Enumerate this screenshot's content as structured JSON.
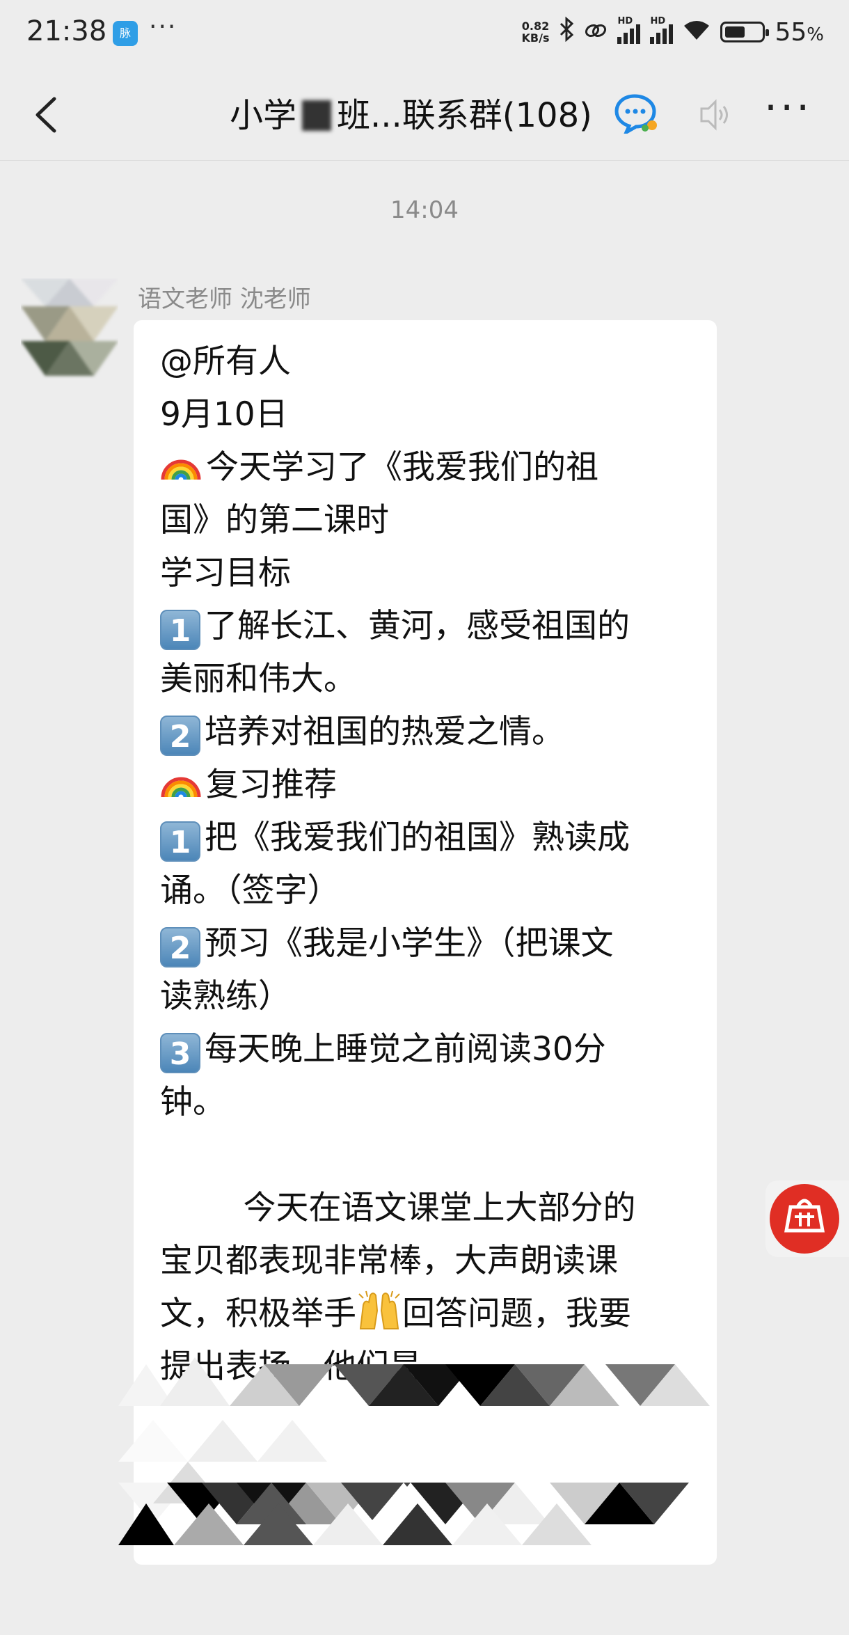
{
  "status_bar": {
    "time": "21:38",
    "app_icon_text": "脉",
    "more_dots": "···",
    "net_speed_value": "0.82",
    "net_speed_unit": "KB/s",
    "hd_label": "HD",
    "battery_percent": "55",
    "battery_suffix": "%"
  },
  "header": {
    "title_part1": "小学",
    "title_part2": "班...联系群(108)",
    "back_icon": "chevron-left-icon",
    "more_icon": "more-dots-icon",
    "more_label": "···"
  },
  "chat": {
    "timestamp": "14:04",
    "message": {
      "sender": "语文老师 沈老师",
      "lines": {
        "l1": "@所有人",
        "l2": "9月10日",
        "l3": "今天学习了《我爱我们的祖",
        "l4": "国》的第二课时",
        "l5": "学习目标",
        "l6": "了解长江、黄河，感受祖国的",
        "l7": "美丽和伟大。",
        "l8": "培养对祖国的热爱之情。",
        "l9": "复习推荐",
        "l10": "把《我爱我们的祖国》熟读成",
        "l11": "诵。（签字）",
        "l12": "预习《我是小学生》（把课文",
        "l13": "读熟练）",
        "l14": "每天晚上睡觉之前阅读30分",
        "l15": "钟。",
        "l16": "        今天在语文课堂上大部分的",
        "l17": "宝贝都表现非常棒，大声朗读课",
        "l18a": "文，积极举手",
        "l18b": "回答问题，我要",
        "l19": "提出表扬，他们是"
      },
      "badges": {
        "one": "1",
        "two": "2",
        "three": "3"
      }
    }
  },
  "colors": {
    "background": "#ededed",
    "bubble": "#ffffff",
    "timestamp": "#8a8a8a",
    "floating_button": "#e02e24"
  }
}
